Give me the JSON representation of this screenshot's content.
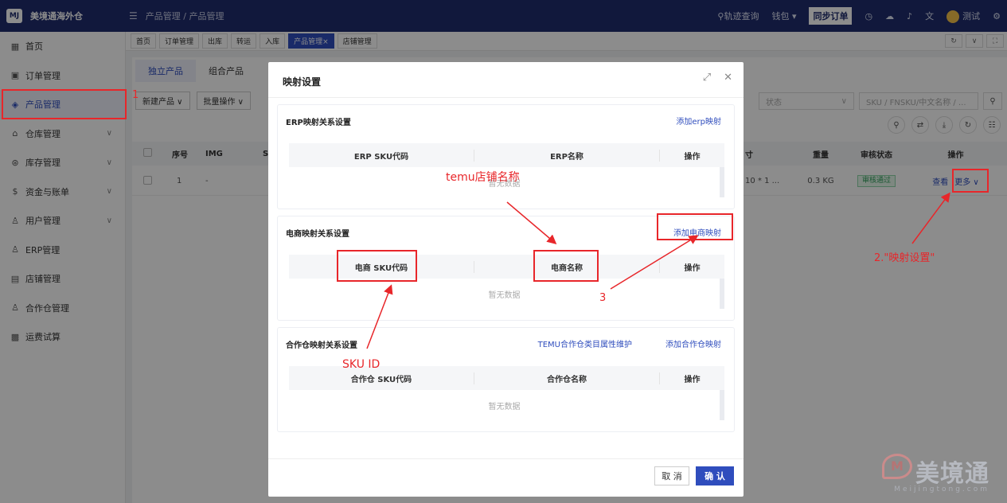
{
  "app": {
    "title": "美境通海外仓",
    "logo_text": "MJ"
  },
  "header": {
    "breadcrumb": "产品管理 / 产品管理",
    "track_query": "轨迹查询",
    "wallet": "钱包",
    "sync_orders": "同步订单",
    "user": "测试"
  },
  "sidebar": {
    "items": [
      {
        "label": "首页",
        "icon": "grid-icon"
      },
      {
        "label": "订单管理",
        "icon": "order-icon"
      },
      {
        "label": "产品管理",
        "icon": "product-icon"
      },
      {
        "label": "仓库管理",
        "icon": "warehouse-icon"
      },
      {
        "label": "库存管理",
        "icon": "inventory-icon"
      },
      {
        "label": "资金与账单",
        "icon": "money-icon"
      },
      {
        "label": "用户管理",
        "icon": "user-icon"
      },
      {
        "label": "ERP管理",
        "icon": "user-icon"
      },
      {
        "label": "店铺管理",
        "icon": "store-icon"
      },
      {
        "label": "合作仓管理",
        "icon": "user-icon"
      },
      {
        "label": "运费试算",
        "icon": "calc-icon"
      }
    ]
  },
  "tags": [
    "首页",
    "订单管理",
    "出库",
    "转运",
    "入库",
    "产品管理×",
    "店铺管理"
  ],
  "page": {
    "tabs": [
      "独立产品",
      "组合产品"
    ],
    "new_product": "新建产品 ∨",
    "batch_ops": "批量操作 ∨",
    "status_placeholder": "状态",
    "search_placeholder": "SKU / FNSKU/中文名称 / ...",
    "table_headers": {
      "no": "序号",
      "img": "IMG",
      "s": "S",
      "size": "寸",
      "weight": "重量",
      "review": "审核状态",
      "ops": "操作"
    },
    "row": {
      "no": "1",
      "img": "-",
      "size": "10 * 1 ...",
      "weight": "0.3 KG",
      "review": "审核通过",
      "view": "查看",
      "more": "更多"
    }
  },
  "dialog": {
    "title": "映射设置",
    "erp": {
      "title": "ERP映射关系设置",
      "add": "添加erp映射",
      "col1": "ERP SKU代码",
      "col2": "ERP名称",
      "col3": "操作",
      "empty": "暂无数据"
    },
    "ecom": {
      "title": "电商映射关系设置",
      "add": "添加电商映射",
      "col1": "电商 SKU代码",
      "col2": "电商名称",
      "col3": "操作",
      "empty": "暂无数据"
    },
    "partner": {
      "title": "合作仓映射关系设置",
      "temu_link": "TEMU合作仓类目属性维护",
      "add": "添加合作仓映射",
      "col1": "合作仓 SKU代码",
      "col2": "合作仓名称",
      "col3": "操作",
      "empty": "暂无数据"
    },
    "cancel": "取 消",
    "confirm": "确 认"
  },
  "annotations": {
    "step1": "1",
    "step2": "2.\"映射设置\"",
    "step3": "3",
    "temu_store": "temu店铺名称",
    "sku_id": "SKU ID"
  },
  "watermark": {
    "main": "美境通",
    "sub": "Meijingtong.com"
  },
  "colors": {
    "primary": "#2f4dbd",
    "header": "#1f2d6e",
    "annotation": "#e8262a"
  }
}
